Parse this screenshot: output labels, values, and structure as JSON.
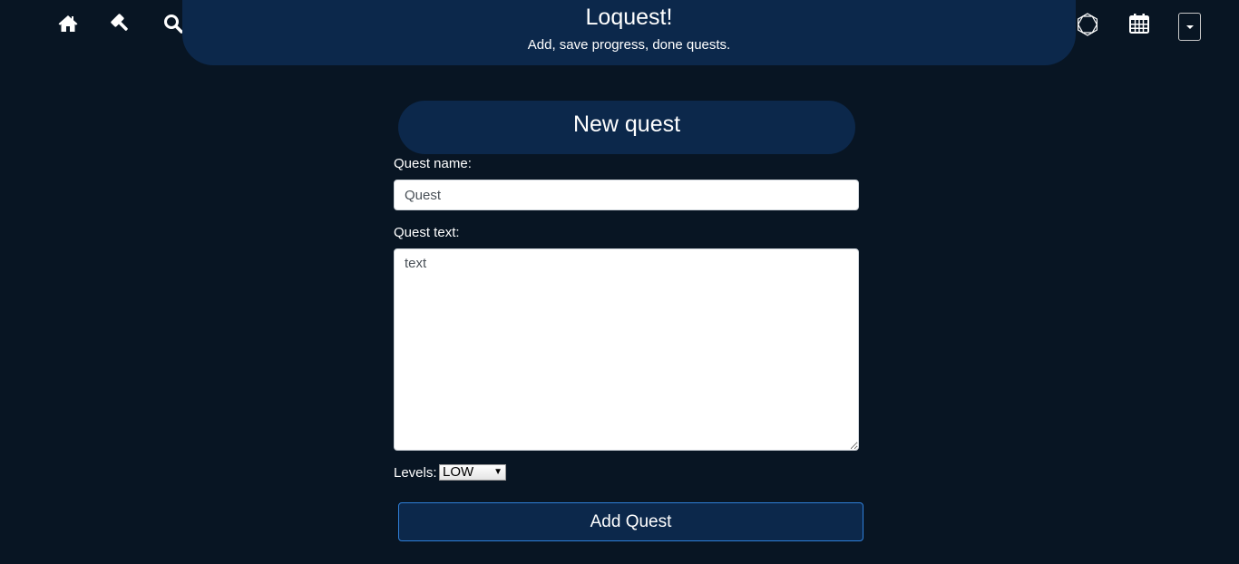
{
  "header": {
    "title": "Loquest!",
    "subtitle": "Add, save progress, done quests."
  },
  "nav": {
    "left_icons": [
      "home-icon",
      "gavel-icon",
      "search-icon"
    ],
    "right_icons": [
      "hexagon-icon",
      "calendar-icon",
      "caret-down-icon"
    ]
  },
  "form": {
    "heading": "New quest",
    "name_label": "Quest name:",
    "name_value": "Quest",
    "text_label": "Quest text:",
    "text_value": "text",
    "level_label": "Levels:",
    "level_value": "LOW",
    "submit_label": "Add Quest"
  },
  "colors": {
    "background": "#081523",
    "panel": "#0c284b",
    "button_border": "#2f7fd8"
  }
}
